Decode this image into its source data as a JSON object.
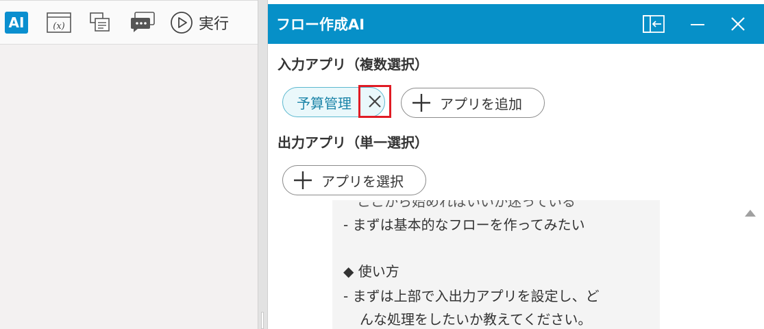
{
  "toolbar": {
    "ai_label": "AI",
    "run_label": "実行",
    "icons": [
      "ai-icon",
      "variable-icon",
      "comment-icon",
      "chat-icon",
      "play-icon"
    ]
  },
  "panel": {
    "title": "フロー作成AI",
    "header_color": "#0690c8",
    "header_icons": [
      "dock-icon",
      "minimize-icon",
      "close-icon"
    ]
  },
  "input_section": {
    "label": "入力アプリ（複数選択）",
    "chips": [
      {
        "label": "予算管理"
      }
    ],
    "add_button": "アプリを追加"
  },
  "output_section": {
    "label": "出力アプリ（単一選択）",
    "select_button": "アプリを選択"
  },
  "message": {
    "cut_line": "ここから始めればいいか迷っている",
    "line1": "-  まずは基本的なフローを作ってみたい",
    "line2": "◆ 使い方",
    "line3": "-  まずは上部で入出力アプリを設定し、ど",
    "line4": "んな処理をしたいか教えてください。"
  },
  "highlight_color": "#e01b24"
}
